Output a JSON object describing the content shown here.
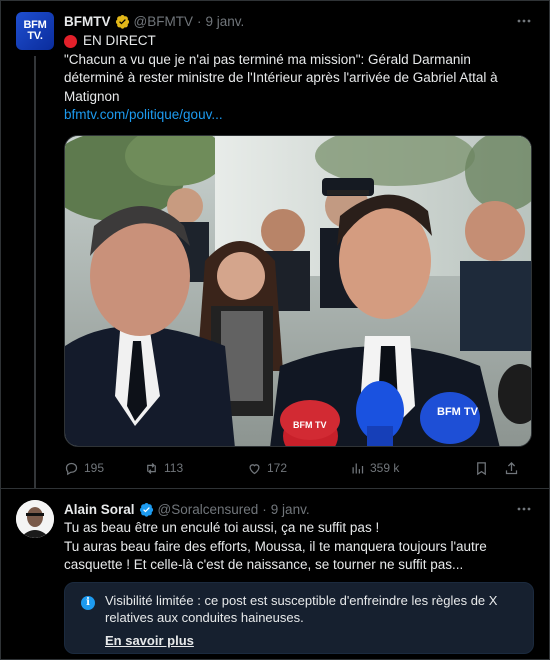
{
  "tweet1": {
    "author_name": "BFMTV",
    "avatar_text": [
      "BFM",
      "TV."
    ],
    "handle": "@BFMTV",
    "date": "9 janv.",
    "live_label": "EN DIRECT",
    "text": "\"Chacun a vu que je n'ai pas terminé ma mission\": Gérald Darmanin déterminé à rester ministre de l'Intérieur après l'arrivée de Gabriel Attal à Matignon",
    "link": "bfmtv.com/politique/gouv...",
    "microphone_labels": [
      "BFM TV",
      "BFM TV"
    ],
    "stats": {
      "replies": "195",
      "reposts": "113",
      "likes": "172",
      "views": "359 k"
    }
  },
  "tweet2": {
    "author_name": "Alain Soral",
    "handle": "@Soralcensured",
    "date": "9 janv.",
    "line1": "Tu as beau être un enculé toi aussi, ça ne suffit pas !",
    "line2": "Tu auras beau faire des efforts, Moussa, il te manquera toujours l'autre casquette ! Et celle-là c'est de naissance, se tourner ne suffit pas...",
    "notice_text": "Visibilité limitée : ce post est susceptible d'enfreindre les règles de X relatives aux conduites haineuses.",
    "notice_link": "En savoir plus"
  },
  "colors": {
    "background": "#000000",
    "text": "#e7e9ea",
    "muted": "#71767b",
    "link": "#1d9bf0",
    "verified_gold": "#e2b719",
    "verified_blue": "#1d9bf0",
    "live_red": "#e2202a",
    "notice_bg": "#16202f"
  },
  "icons": [
    "more-icon",
    "verified-gold-icon",
    "verified-blue-icon",
    "reply-icon",
    "repost-icon",
    "like-icon",
    "views-icon",
    "bookmark-icon",
    "share-icon",
    "info-icon"
  ]
}
